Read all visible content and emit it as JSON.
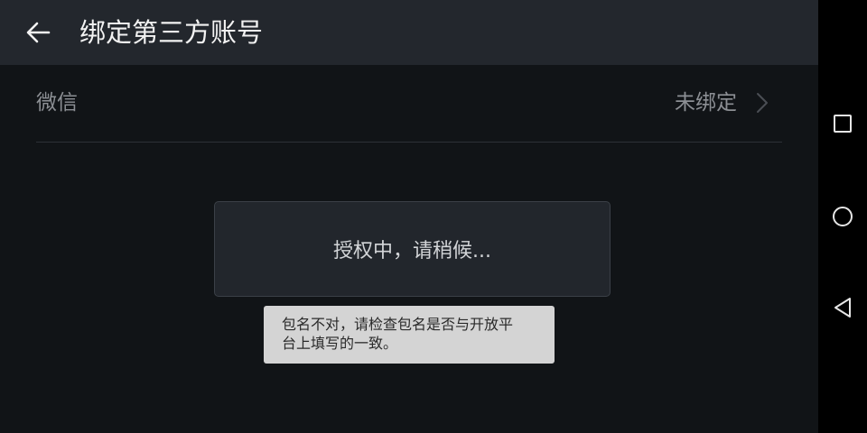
{
  "header": {
    "back_icon": "arrow-left-icon",
    "title": "绑定第三方账号"
  },
  "bindings": [
    {
      "label": "微信",
      "status": "未绑定",
      "icon": "chevron-right-icon"
    }
  ],
  "dialog": {
    "message": "授权中，请稍候..."
  },
  "toast": {
    "line1": "包名不对，请检查包名是否与开放平",
    "line2": "台上填写的一致。"
  },
  "system_nav": {
    "items": [
      "recents-square-icon",
      "home-circle-icon",
      "back-triangle-icon"
    ]
  },
  "colors": {
    "header_bg": "#23272d",
    "screen_bg": "#111417",
    "toast_bg": "#d4d4d4"
  }
}
